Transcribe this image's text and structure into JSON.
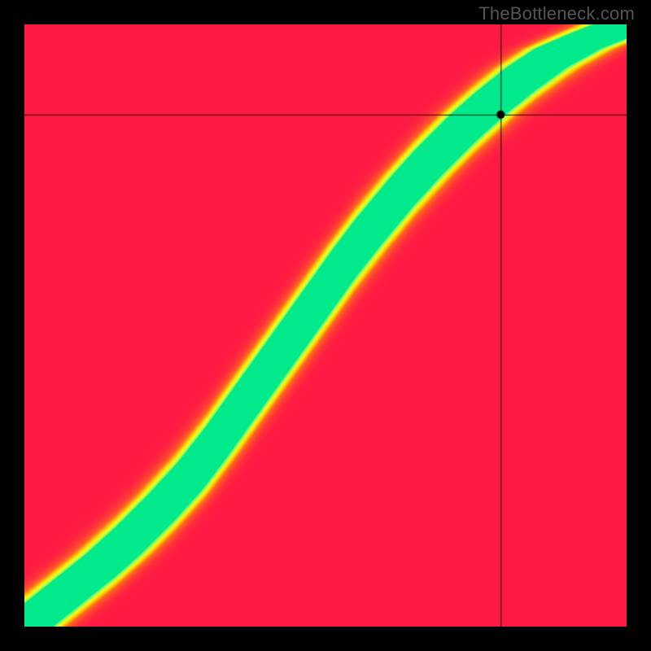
{
  "watermark": "TheBottleneck.com",
  "chart_data": {
    "type": "heatmap",
    "title": "",
    "xlabel": "",
    "ylabel": "",
    "xlim": [
      0,
      100
    ],
    "ylim": [
      0,
      100
    ],
    "marker": {
      "x": 79.2,
      "y": 85.0
    },
    "colorscale": [
      {
        "t": 0.0,
        "hex": "#ff1a44"
      },
      {
        "t": 0.35,
        "hex": "#ff6a1f"
      },
      {
        "t": 0.55,
        "hex": "#ffd400"
      },
      {
        "t": 0.75,
        "hex": "#e9ff2e"
      },
      {
        "t": 0.92,
        "hex": "#7fff60"
      },
      {
        "t": 1.0,
        "hex": "#00e98b"
      }
    ],
    "ideal_curve": {
      "note": "y = f(x) giving the zero-bottleneck ridge; values are percentages",
      "x": [
        0,
        5,
        10,
        15,
        20,
        25,
        30,
        35,
        40,
        45,
        50,
        55,
        60,
        65,
        70,
        75,
        80,
        85,
        90,
        95,
        100
      ],
      "y": [
        0,
        4,
        8,
        12,
        17,
        22,
        28,
        35,
        42,
        49,
        56,
        63,
        69,
        75,
        80,
        85,
        89,
        93,
        96,
        98,
        100
      ]
    },
    "band_halfwidth_percent": 4.0,
    "falloff_sharpness": 0.045
  }
}
